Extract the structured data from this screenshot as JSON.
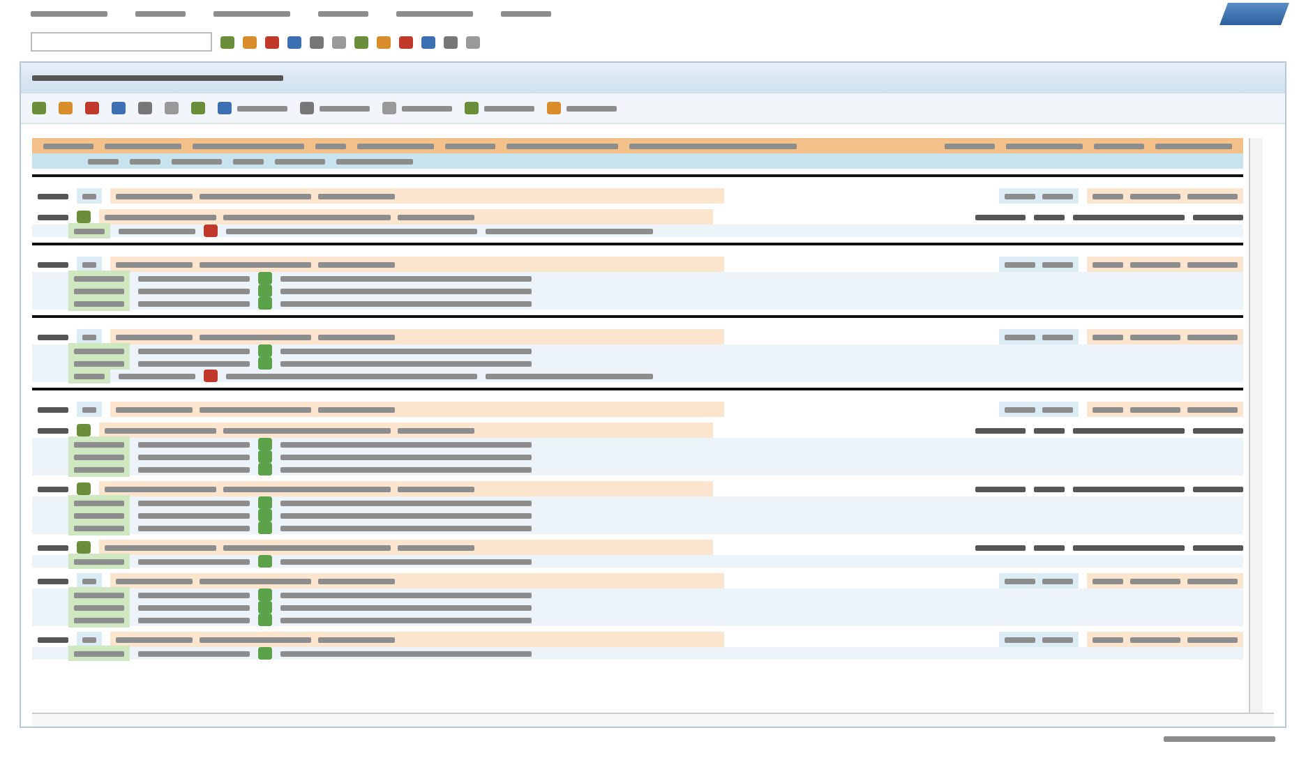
{
  "menu_bar": {
    "items": [
      {
        "kind": "menu"
      },
      {
        "kind": "menu"
      },
      {
        "kind": "menu"
      },
      {
        "kind": "menu"
      },
      {
        "kind": "menu"
      },
      {
        "kind": "menu"
      }
    ]
  },
  "toolbar": {
    "command_field": {
      "kind": "input"
    },
    "buttons": [
      {
        "kind": "icon"
      },
      {
        "kind": "icon"
      },
      {
        "kind": "icon"
      },
      {
        "kind": "icon"
      },
      {
        "kind": "icon"
      },
      {
        "kind": "icon"
      },
      {
        "kind": "icon"
      },
      {
        "kind": "icon"
      },
      {
        "kind": "icon"
      },
      {
        "kind": "icon"
      },
      {
        "kind": "icon"
      },
      {
        "kind": "icon"
      }
    ]
  },
  "title_bar": {
    "kind": "title"
  },
  "app_toolbar": {
    "buttons": [
      {
        "kind": "icon"
      },
      {
        "kind": "icon"
      },
      {
        "kind": "icon"
      },
      {
        "kind": "icon"
      },
      {
        "kind": "icon"
      },
      {
        "kind": "icon"
      },
      {
        "kind": "icon"
      },
      {
        "kind": "labeled"
      },
      {
        "kind": "labeled"
      },
      {
        "kind": "labeled"
      },
      {
        "kind": "labeled"
      },
      {
        "kind": "labeled"
      }
    ]
  },
  "groups": [
    {
      "separator": true,
      "rows": [
        {
          "kind": "total"
        },
        {
          "kind": "document",
          "lines": [
            {
              "kind": "note"
            }
          ]
        }
      ]
    },
    {
      "separator": true,
      "rows": [
        {
          "kind": "total",
          "lines": [
            {
              "kind": "item"
            },
            {
              "kind": "item"
            },
            {
              "kind": "item"
            }
          ]
        }
      ]
    },
    {
      "separator": true,
      "rows": [
        {
          "kind": "total",
          "lines": [
            {
              "kind": "item"
            },
            {
              "kind": "item"
            },
            {
              "kind": "note"
            }
          ]
        }
      ]
    },
    {
      "rows": [
        {
          "kind": "total"
        },
        {
          "kind": "document",
          "lines": [
            {
              "kind": "item"
            },
            {
              "kind": "item"
            },
            {
              "kind": "item"
            }
          ]
        },
        {
          "kind": "document",
          "lines": [
            {
              "kind": "item"
            },
            {
              "kind": "item"
            },
            {
              "kind": "item"
            }
          ]
        },
        {
          "kind": "document",
          "lines": [
            {
              "kind": "item"
            }
          ]
        },
        {
          "kind": "total",
          "lines": [
            {
              "kind": "item"
            },
            {
              "kind": "item"
            },
            {
              "kind": "item"
            }
          ]
        },
        {
          "kind": "total",
          "lines": [
            {
              "kind": "item"
            }
          ]
        }
      ]
    }
  ]
}
